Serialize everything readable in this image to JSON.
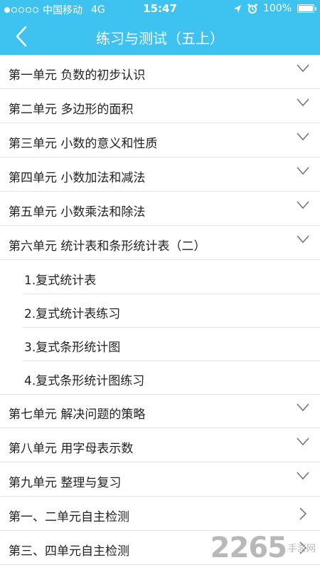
{
  "status": {
    "carrier": "中国移动",
    "network": "4G",
    "time": "15:47",
    "battery": "100%",
    "icons": [
      "location-icon",
      "alarm-icon",
      "battery-icon"
    ]
  },
  "nav": {
    "title": "练习与测试（五上）",
    "back_icon": "chevron-left-icon"
  },
  "units": [
    {
      "label": "第一单元 负数的初步认识"
    },
    {
      "label": "第二单元 多边形的面积"
    },
    {
      "label": "第三单元 小数的意义和性质"
    },
    {
      "label": "第四单元 小数加法和减法"
    },
    {
      "label": "第五单元 小数乘法和除法"
    },
    {
      "label": "第六单元 统计表和条形统计表（二）"
    },
    {
      "label": "第七单元 解决问题的策略"
    },
    {
      "label": "第八单元 用字母表示数"
    },
    {
      "label": "第九单元 整理与复习"
    }
  ],
  "sub_items": [
    {
      "label": "1.复式统计表"
    },
    {
      "label": "2.复式统计表练习"
    },
    {
      "label": "3.复式条形统计图"
    },
    {
      "label": "4.复式条形统计图练习"
    }
  ],
  "tests": [
    {
      "label": "第一、二单元自主检测"
    },
    {
      "label": "第三、四单元自主检测"
    }
  ],
  "watermark": {
    "brand": "2265",
    "sub": "手游网"
  },
  "colors": {
    "header": "#3ec3f1",
    "divider": "#e2e2e2",
    "text": "#222222"
  }
}
